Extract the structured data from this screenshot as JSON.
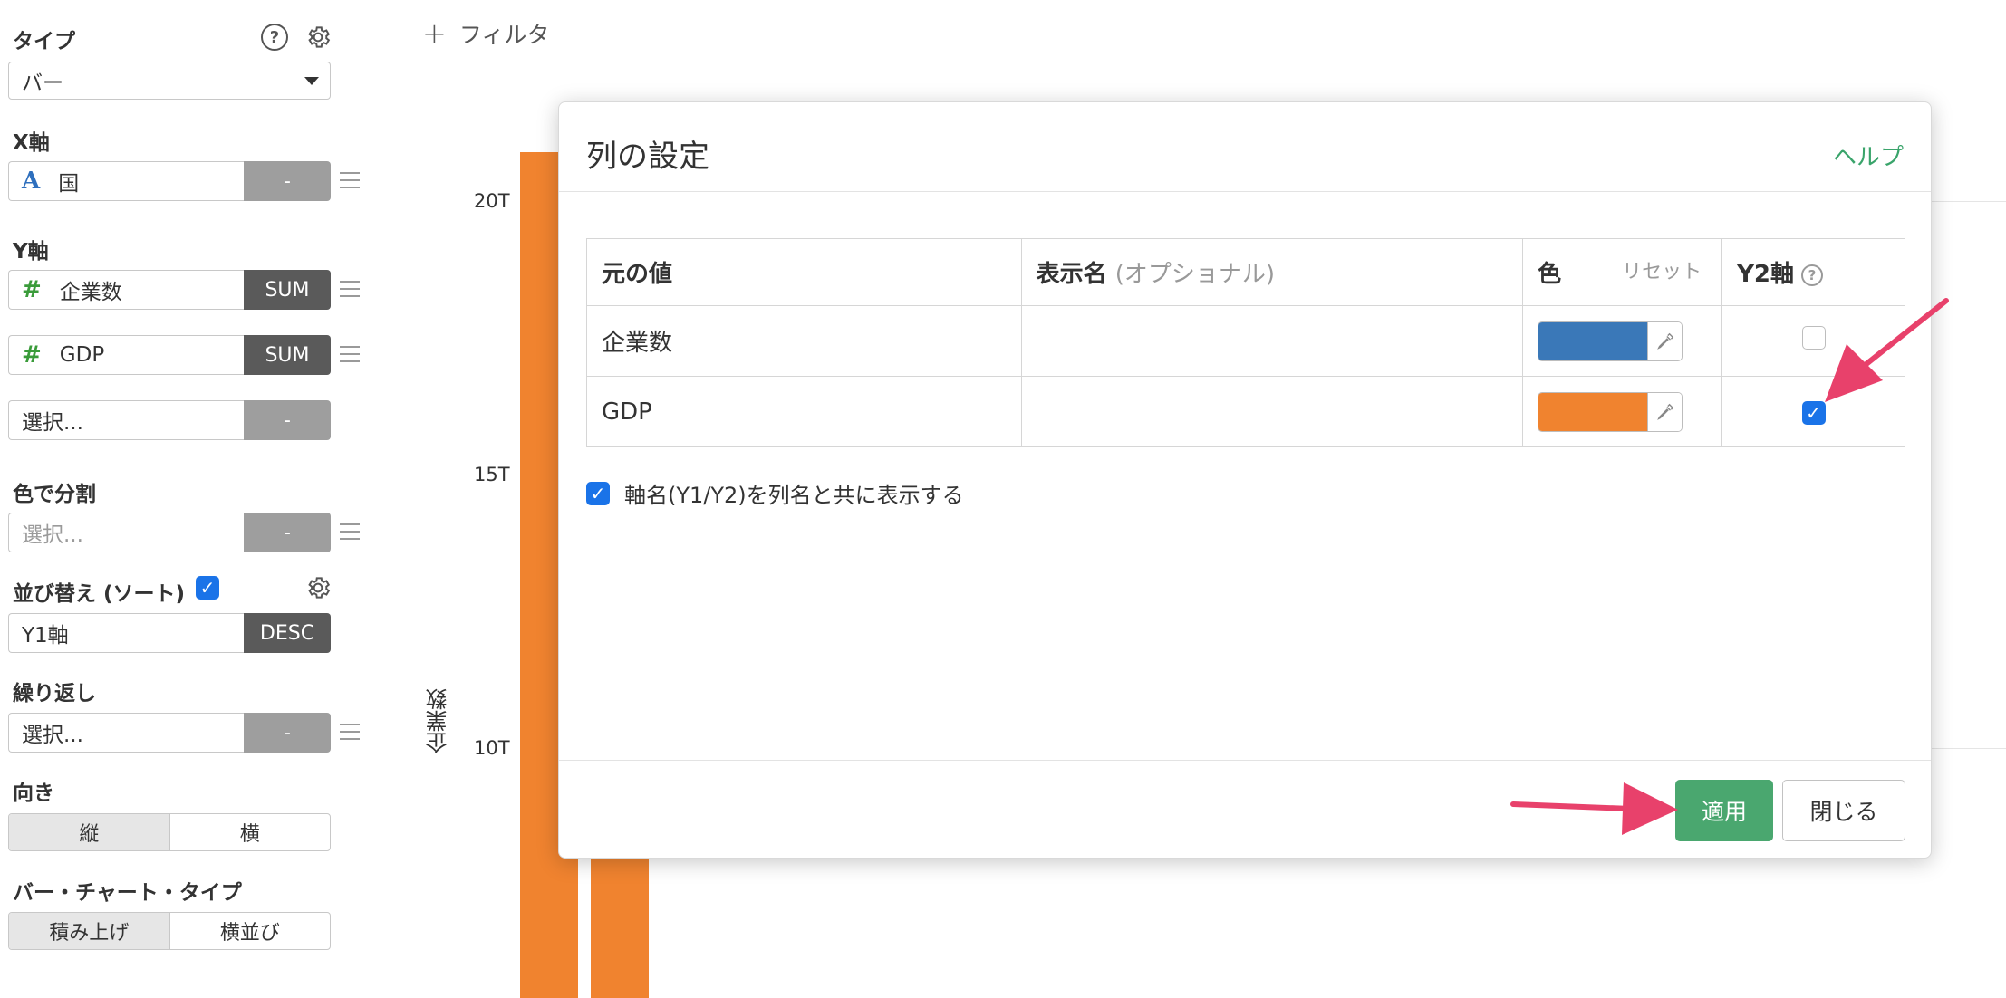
{
  "sidebar": {
    "type_label": "タイプ",
    "type_value": "バー",
    "x_axis_label": "X軸",
    "x_field": {
      "prefix": "A",
      "name": "国",
      "agg": "-"
    },
    "y_axis_label": "Y軸",
    "y_fields": [
      {
        "prefix": "#",
        "name": "企業数",
        "agg": "SUM"
      },
      {
        "prefix": "#",
        "name": "GDP",
        "agg": "SUM"
      }
    ],
    "y_select": {
      "placeholder": "選択...",
      "agg": "-"
    },
    "color_split_label": "色で分割",
    "color_split": {
      "placeholder": "選択...",
      "agg": "-"
    },
    "sort_label": "並び替え (ソート)",
    "sort_checked": true,
    "sort_field": {
      "name": "Y1軸",
      "order": "DESC"
    },
    "repeat_label": "繰り返し",
    "repeat_select": {
      "placeholder": "選択...",
      "agg": "-"
    },
    "orientation_label": "向き",
    "orientation_options": [
      "縦",
      "横"
    ],
    "orientation_selected": "縦",
    "bar_type_label": "バー・チャート・タイプ",
    "bar_type_options": [
      "積み上げ",
      "横並び"
    ],
    "bar_type_selected": "積み上げ"
  },
  "chart": {
    "filter_label": "フィルタ",
    "y_ticks": [
      "20T",
      "15T",
      "10T"
    ],
    "y_axis_title": "企業数",
    "bar_color": "#f0832f"
  },
  "modal": {
    "title": "列の設定",
    "help_link": "ヘルプ",
    "columns": {
      "original": "元の値",
      "display": "表示名",
      "display_opt": "(オプショナル)",
      "color": "色",
      "reset": "リセット",
      "y2": "Y2軸"
    },
    "rows": [
      {
        "name": "企業数",
        "display": "",
        "color": "#3a78b8",
        "y2": false
      },
      {
        "name": "GDP",
        "display": "",
        "color": "#f0832f",
        "y2": true
      }
    ],
    "show_axis_label": "軸名(Y1/Y2)を列名と共に表示する",
    "show_axis_checked": true,
    "apply_button": "適用",
    "close_button": "閉じる"
  },
  "annotation_color": "#e8416b"
}
